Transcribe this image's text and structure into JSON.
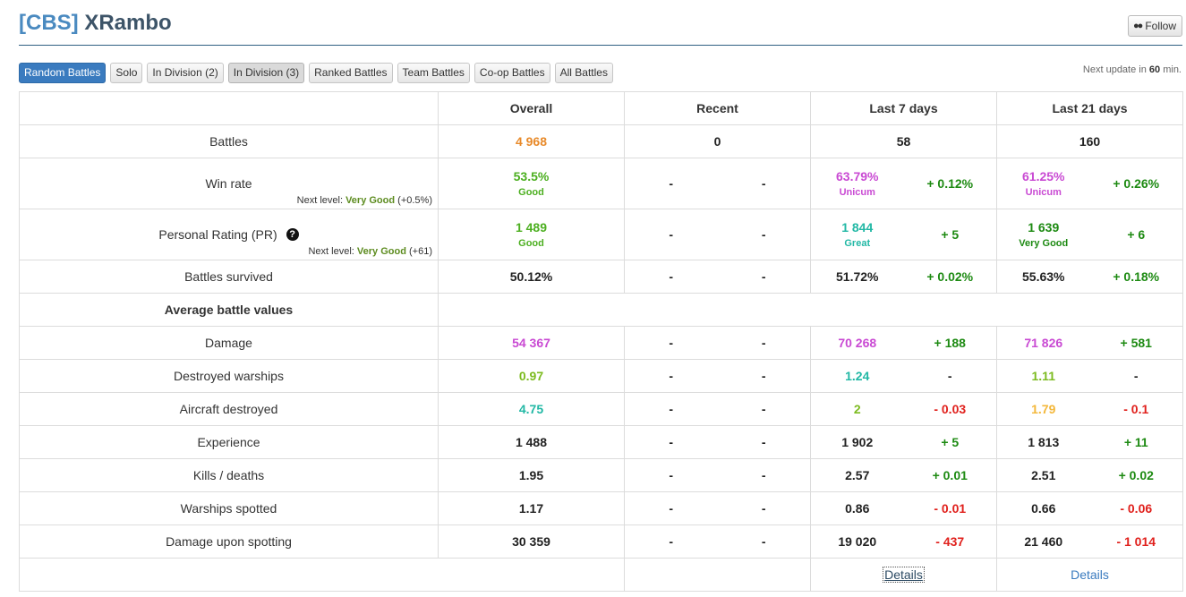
{
  "header": {
    "tag": "[CBS]",
    "name": "XRambo",
    "follow_label": "Follow",
    "follow_icon": "binoculars-icon"
  },
  "tabs": [
    {
      "label": "Random Battles",
      "state": "active"
    },
    {
      "label": "Solo",
      "state": "normal"
    },
    {
      "label": "In Division (2)",
      "state": "normal"
    },
    {
      "label": "In Division (3)",
      "state": "pressed"
    },
    {
      "label": "Ranked Battles",
      "state": "normal"
    },
    {
      "label": "Team Battles",
      "state": "normal"
    },
    {
      "label": "Co-op Battles",
      "state": "normal"
    },
    {
      "label": "All Battles",
      "state": "normal"
    }
  ],
  "update": {
    "prefix": "Next update in ",
    "minutes": "60",
    "suffix": " min."
  },
  "columns": {
    "overall": "Overall",
    "recent": "Recent",
    "last7": "Last 7 days",
    "last21": "Last 21 days"
  },
  "battles": {
    "label": "Battles",
    "overall": "4 968",
    "recent": "0",
    "last7": "58",
    "last21": "160"
  },
  "winrate": {
    "label": "Win rate",
    "next_prefix": "Next level: ",
    "next_level": "Very Good",
    "next_delta": "(+0.5%)",
    "overall": "53.5%",
    "overall_grade": "Good",
    "recent_a": "-",
    "recent_b": "-",
    "last7": "63.79%",
    "last7_grade": "Unicum",
    "last7_diff": "+ 0.12%",
    "last21": "61.25%",
    "last21_grade": "Unicum",
    "last21_diff": "+ 0.26%"
  },
  "pr": {
    "label": "Personal Rating (PR)",
    "help_icon": "question-circle-icon",
    "next_prefix": "Next level: ",
    "next_level": "Very Good",
    "next_delta": "(+61)",
    "overall": "1 489",
    "overall_grade": "Good",
    "recent_a": "-",
    "recent_b": "-",
    "last7": "1 844",
    "last7_grade": "Great",
    "last7_diff": "+ 5",
    "last21": "1 639",
    "last21_grade": "Very Good",
    "last21_diff": "+ 6"
  },
  "survived": {
    "label": "Battles survived",
    "overall": "50.12%",
    "recent_a": "-",
    "recent_b": "-",
    "last7": "51.72%",
    "last7_diff": "+ 0.02%",
    "last21": "55.63%",
    "last21_diff": "+ 0.18%"
  },
  "avg_section": "Average battle values",
  "avg_rows": [
    {
      "label": "Damage",
      "overall": "54 367",
      "oc": "c-purple",
      "recent_a": "-",
      "recent_b": "-",
      "last7": "70 268",
      "l7c": "c-purple",
      "last7_diff": "+ 188",
      "d7c": "c-dgreen",
      "last21": "71 826",
      "l21c": "c-purple",
      "last21_diff": "+ 581",
      "d21c": "c-dgreen"
    },
    {
      "label": "Destroyed warships",
      "overall": "0.97",
      "oc": "c-lime",
      "recent_a": "-",
      "recent_b": "-",
      "last7": "1.24",
      "l7c": "c-teal",
      "last7_diff": "-",
      "d7c": "c-dark",
      "last21": "1.11",
      "l21c": "c-lime",
      "last21_diff": "-",
      "d21c": "c-dark"
    },
    {
      "label": "Aircraft destroyed",
      "overall": "4.75",
      "oc": "c-teal",
      "recent_a": "-",
      "recent_b": "-",
      "last7": "2",
      "l7c": "c-lime",
      "last7_diff": "- 0.03",
      "d7c": "c-red",
      "last21": "1.79",
      "l21c": "c-yellow",
      "last21_diff": "- 0.1",
      "d21c": "c-red"
    },
    {
      "label": "Experience",
      "overall": "1 488",
      "oc": "c-dark",
      "recent_a": "-",
      "recent_b": "-",
      "last7": "1 902",
      "l7c": "c-dark",
      "last7_diff": "+ 5",
      "d7c": "c-dgreen",
      "last21": "1 813",
      "l21c": "c-dark",
      "last21_diff": "+ 11",
      "d21c": "c-dgreen"
    },
    {
      "label": "Kills / deaths",
      "overall": "1.95",
      "oc": "c-dark",
      "recent_a": "-",
      "recent_b": "-",
      "last7": "2.57",
      "l7c": "c-dark",
      "last7_diff": "+ 0.01",
      "d7c": "c-dgreen",
      "last21": "2.51",
      "l21c": "c-dark",
      "last21_diff": "+ 0.02",
      "d21c": "c-dgreen"
    },
    {
      "label": "Warships spotted",
      "overall": "1.17",
      "oc": "c-dark",
      "recent_a": "-",
      "recent_b": "-",
      "last7": "0.86",
      "l7c": "c-dark",
      "last7_diff": "- 0.01",
      "d7c": "c-red",
      "last21": "0.66",
      "l21c": "c-dark",
      "last21_diff": "- 0.06",
      "d21c": "c-red"
    },
    {
      "label": "Damage upon spotting",
      "overall": "30 359",
      "oc": "c-dark",
      "recent_a": "-",
      "recent_b": "-",
      "last7": "19 020",
      "l7c": "c-dark",
      "last7_diff": "- 437",
      "d7c": "c-red",
      "last21": "21 460",
      "l21c": "c-dark",
      "last21_diff": "- 1 014",
      "d21c": "c-red"
    }
  ],
  "footer": {
    "details7": "Details",
    "details21": "Details"
  },
  "colors": {
    "accent": "#3a7bbf",
    "orange": "#e88a2a",
    "green": "#4caf20",
    "purple": "#c94ad3",
    "teal": "#22b8a5",
    "dark_green": "#1d8a12",
    "red": "#e0201c"
  }
}
